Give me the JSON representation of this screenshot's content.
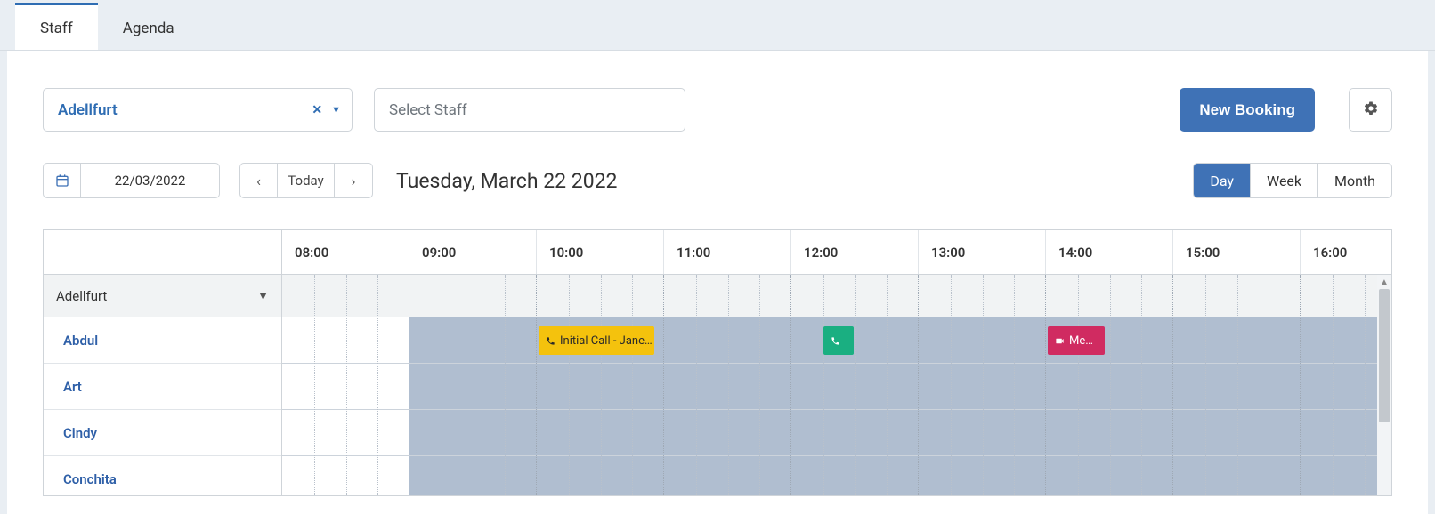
{
  "tabs": {
    "staff": "Staff",
    "agenda": "Agenda"
  },
  "filters": {
    "location": "Adellfurt",
    "staff_placeholder": "Select Staff"
  },
  "buttons": {
    "new_booking": "New Booking"
  },
  "date": {
    "value": "22/03/2022",
    "today": "Today",
    "heading": "Tuesday, March 22 2022"
  },
  "views": {
    "day": "Day",
    "week": "Week",
    "month": "Month"
  },
  "time_header": [
    "08:00",
    "09:00",
    "10:00",
    "11:00",
    "12:00",
    "13:00",
    "14:00",
    "15:00",
    "16:00"
  ],
  "group": {
    "name": "Adellfurt"
  },
  "staff": [
    {
      "name": "Abdul"
    },
    {
      "name": "Art"
    },
    {
      "name": "Cindy"
    },
    {
      "name": "Conchita"
    }
  ],
  "events": {
    "e1": {
      "label": "Initial Call - Jane…",
      "icon": "phone",
      "color": "yellow",
      "staff_index": 1,
      "start": "09:55",
      "end": "10:55"
    },
    "e2": {
      "label": "",
      "icon": "phone",
      "color": "green",
      "staff_index": 1,
      "start": "12:15",
      "end": "12:30"
    },
    "e3": {
      "label": "Me…",
      "icon": "video",
      "color": "pink",
      "staff_index": 1,
      "start": "14:00",
      "end": "14:30"
    }
  },
  "availability": {
    "start": "09:00",
    "end": "16:30"
  }
}
